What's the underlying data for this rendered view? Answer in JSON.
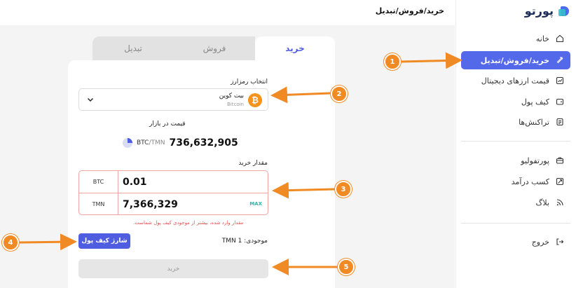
{
  "brand": {
    "logo_text": "پورتو"
  },
  "header": {
    "title": "خرید/فروش/تبدیل"
  },
  "sidebar": {
    "items": [
      {
        "label": "خانه",
        "icon": "home-icon"
      },
      {
        "label": "خرید/فروش/تبدیل",
        "icon": "exchange-icon",
        "active": true
      },
      {
        "label": "قیمت ارزهای دیجیتال",
        "icon": "chart-icon"
      },
      {
        "label": "کیف پول",
        "icon": "wallet-icon"
      },
      {
        "label": "تراکنش‌ها",
        "icon": "transactions-icon"
      },
      {
        "label": "پورتفولیو",
        "icon": "portfolio-icon"
      },
      {
        "label": "کسب درآمد",
        "icon": "earn-icon"
      },
      {
        "label": "بلاگ",
        "icon": "rss-icon"
      },
      {
        "label": "خروج",
        "icon": "logout-icon"
      }
    ]
  },
  "tabs": {
    "buy": "خرید",
    "sell": "فروش",
    "convert": "تبدیل"
  },
  "form": {
    "select_label": "انتخاب رمزارز",
    "coin_fa": "بیت کوین",
    "coin_en": "Bitcoin",
    "coin_symbol": "₿",
    "market_price_label": "قیمت در بازار",
    "pair_base": "BTC",
    "pair_quote": "/TMN",
    "price": "736,632,905",
    "amount_label": "مقدار خرید",
    "btc_unit": "BTC",
    "btc_value": "0.01",
    "tmn_unit": "TMN",
    "tmn_value": "7,366,329",
    "max_label": "MAX",
    "error": "مقدار وارد شده، بیشتر از موجودی کیف پول شماست.",
    "balance": "موجودی: 1 TMN",
    "charge_button": "شارژ کیف پول",
    "buy_button": "خرید"
  },
  "annotations": [
    "1",
    "2",
    "3",
    "4",
    "5"
  ],
  "colors": {
    "accent": "#5468ea",
    "annotation": "#f08a24",
    "error": "#e05252",
    "bitcoin": "#f7931a"
  }
}
